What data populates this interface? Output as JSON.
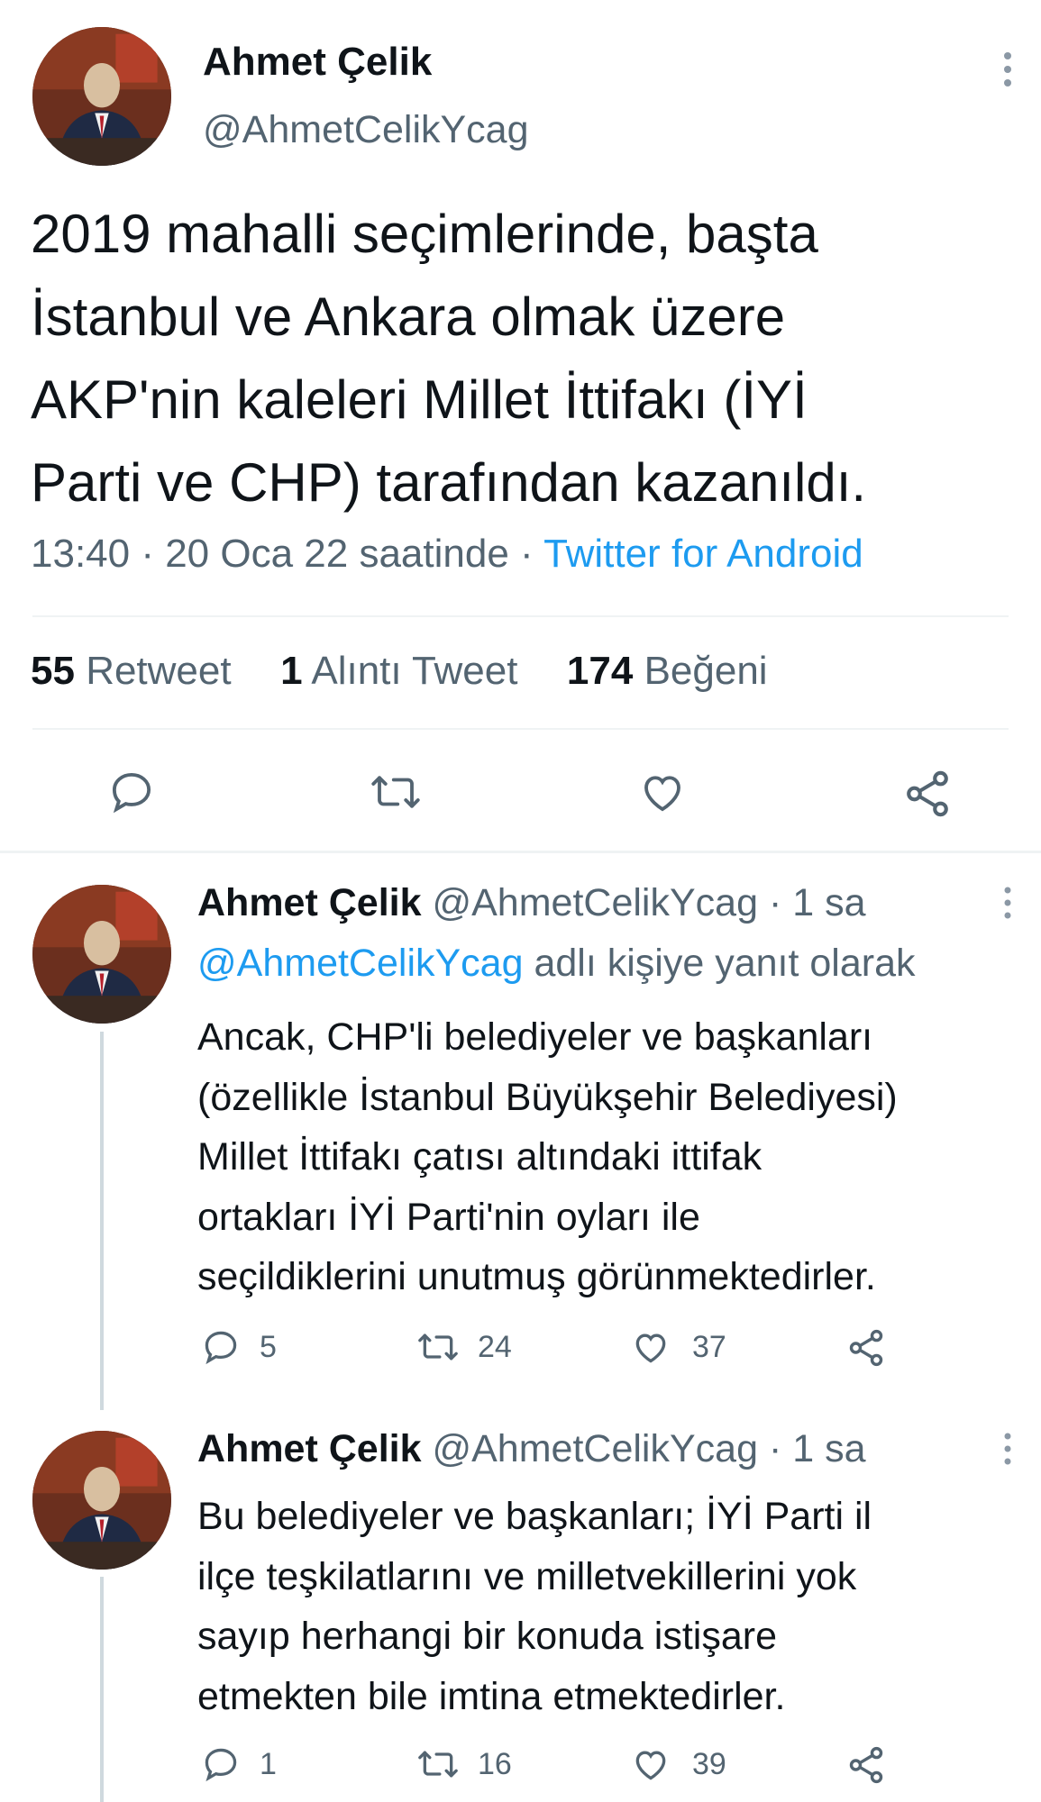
{
  "main_tweet": {
    "author_name": "Ahmet Çelik",
    "author_handle": "@AhmetCelikYcag",
    "text_lines": [
      "2019 mahalli seçimlerinde, başta",
      "İstanbul ve Ankara olmak üzere",
      "AKP'nin kaleleri Millet İttifakı (İYİ",
      "Parti ve CHP) tarafından kazanıldı."
    ],
    "timestamp": "13:40 · 20 Oca 22 saatinde ·",
    "source": "Twitter for Android",
    "stats": {
      "retweets_count": "55",
      "retweets_label": "Retweet",
      "quotes_count": "1",
      "quotes_label": "Alıntı Tweet",
      "likes_count": "174",
      "likes_label": "Beğeni"
    }
  },
  "replies": [
    {
      "author_name": "Ahmet Çelik",
      "author_handle": "@AhmetCelikYcag",
      "time": "· 1 sa",
      "replying_to_handle": "@AhmetCelikYcag",
      "replying_to_suffix": "adlı kişiye yanıt olarak",
      "text_lines": [
        "Ancak, CHP'li belediyeler ve başkanları",
        "(özellikle İstanbul Büyükşehir Belediyesi)",
        "Millet İttifakı çatısı altındaki ittifak",
        "ortakları İYİ Parti'nin oyları ile",
        "seçildiklerini unutmuş görünmektedirler."
      ],
      "reply_count": "5",
      "retweet_count": "24",
      "like_count": "37"
    },
    {
      "author_name": "Ahmet Çelik",
      "author_handle": "@AhmetCelikYcag",
      "time": "· 1 sa",
      "text_lines": [
        "Bu belediyeler ve başkanları; İYİ Parti il",
        "ilçe teşkilatlarını ve milletvekillerini yok",
        "sayıp herhangi bir konuda istişare",
        "etmekten bile imtina etmektedirler."
      ],
      "reply_count": "1",
      "retweet_count": "16",
      "like_count": "39"
    }
  ],
  "icons": [
    "reply-icon",
    "retweet-icon",
    "like-icon",
    "share-icon",
    "more-icon"
  ],
  "colors": {
    "link": "#1d9bf0",
    "muted": "#536471",
    "text": "#0f1419",
    "divider": "#eff3f4"
  }
}
